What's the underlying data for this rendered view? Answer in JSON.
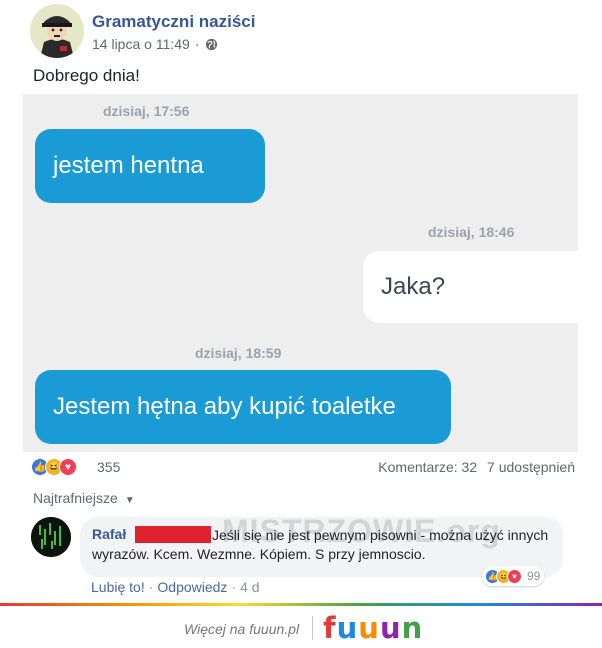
{
  "post": {
    "author": "Gramatyczni naziści",
    "date": "14 lipca o 11:49",
    "separator": "·",
    "text": "Dobrego dnia!"
  },
  "chat": {
    "messages": [
      {
        "time": "dzisiaj, 17:56",
        "text": "jestem hentna",
        "side": "left"
      },
      {
        "time": "dzisiaj, 18:46",
        "text": "Jaka?",
        "side": "right"
      },
      {
        "time": "dzisiaj, 18:59",
        "text": "Jestem hętna aby kupić toaletke",
        "side": "left"
      }
    ]
  },
  "reactions": {
    "count": "355",
    "comments": "Komentarze: 32",
    "shares": "7 udostępnień",
    "icons": [
      "like-icon",
      "haha-icon",
      "love-icon"
    ]
  },
  "sort_label": "Najtrafniejsze",
  "comment": {
    "author": "Rafał",
    "text": "Jeśli się nie jest pewnym pisowni - można użyć innych wyrazów. Kcem. Wezmne. Kópiem. S przy jemnoscio.",
    "watermark": "MISTRZOWIE.org",
    "reaction_count": "99",
    "like_label": "Lubię to!",
    "reply_label": "Odpowiedz",
    "age": "4 d"
  },
  "footer": {
    "text": "Więcej na fuuun.pl",
    "logo": "fuuun"
  },
  "colors": {
    "author": "#365899",
    "bubble_blue": "#1b9bd6",
    "chat_bg": "#eeeeee",
    "logo_letters": [
      "#e53935",
      "#1e88e5",
      "#fb8c00",
      "#8e24aa",
      "#43a047"
    ]
  }
}
